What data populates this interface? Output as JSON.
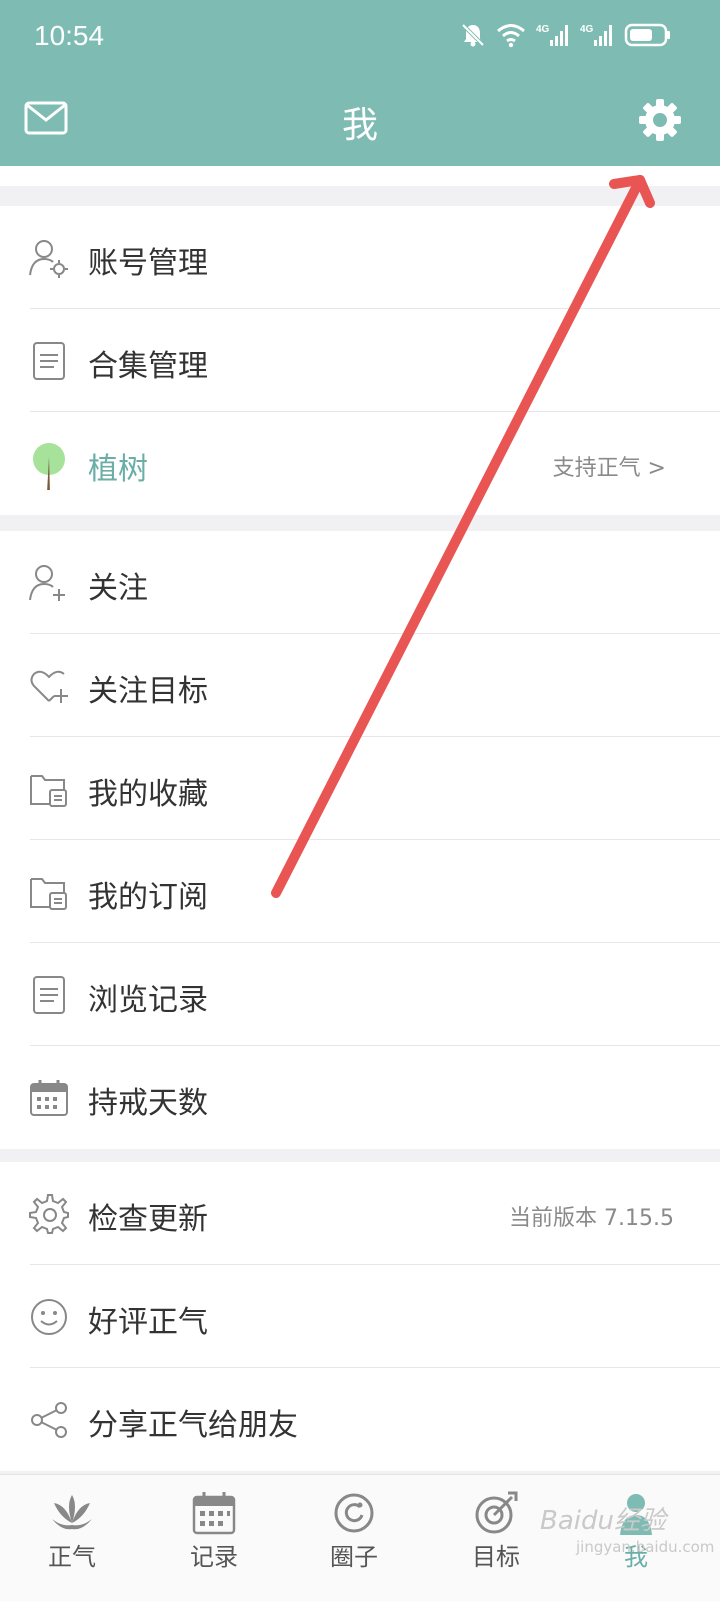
{
  "status": {
    "time": "10:54",
    "network1": "4G",
    "network2": "4G"
  },
  "header": {
    "title": "我",
    "mail_icon": "mail-icon",
    "settings_icon": "gear-icon"
  },
  "group1": [
    {
      "label": "账号管理",
      "icon": "user-gear-icon"
    },
    {
      "label": "合集管理",
      "icon": "document-icon"
    },
    {
      "label": "植树",
      "icon": "tree-icon",
      "right": "支持正气 >"
    }
  ],
  "group2": [
    {
      "label": "关注",
      "icon": "user-plus-icon"
    },
    {
      "label": "关注目标",
      "icon": "heart-plus-icon"
    },
    {
      "label": "我的收藏",
      "icon": "folder-icon"
    },
    {
      "label": "我的订阅",
      "icon": "folder-icon"
    },
    {
      "label": "浏览记录",
      "icon": "document-icon"
    },
    {
      "label": "持戒天数",
      "icon": "calendar-icon"
    }
  ],
  "group3": [
    {
      "label": "检查更新",
      "icon": "gear-icon",
      "right": "当前版本 7.15.5"
    },
    {
      "label": "好评正气",
      "icon": "smile-icon"
    },
    {
      "label": "分享正气给朋友",
      "icon": "share-icon"
    }
  ],
  "tabs": [
    {
      "label": "正气",
      "icon": "lotus-icon"
    },
    {
      "label": "记录",
      "icon": "calendar-icon"
    },
    {
      "label": "圈子",
      "icon": "circle-icon"
    },
    {
      "label": "目标",
      "icon": "target-icon"
    },
    {
      "label": "我",
      "icon": "person-icon",
      "active": true
    }
  ],
  "colors": {
    "accent": "#7ebcb3",
    "accent_text": "#6aaea7",
    "arrow": "#e85552"
  },
  "watermark": {
    "text": "Baidu经验",
    "sub": "jingyan.baidu.com"
  }
}
